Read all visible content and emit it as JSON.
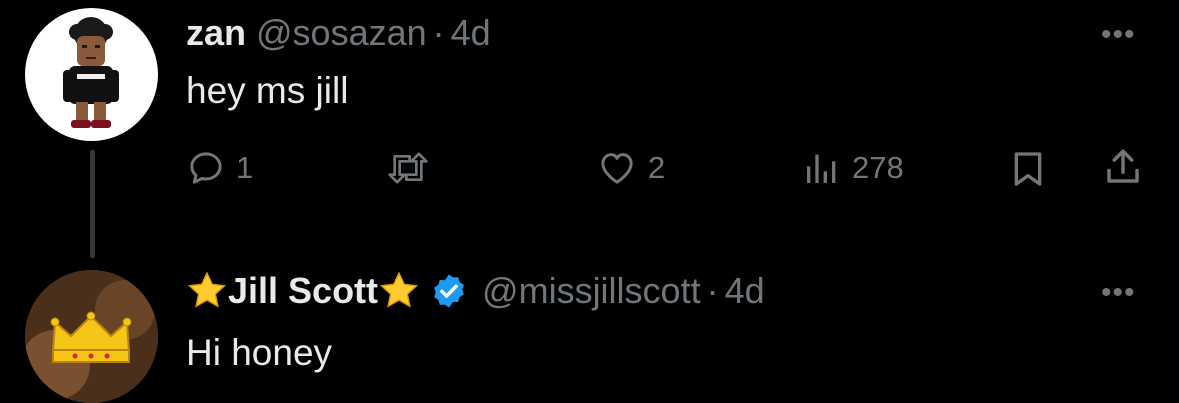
{
  "tweet1": {
    "name": "zan",
    "handle": "@sosazan",
    "separator": "·",
    "time": "4d",
    "text": "hey ms jill",
    "more_label": "•••",
    "actions": {
      "reply_count": "1",
      "like_count": "2",
      "views_count": "278"
    }
  },
  "tweet2": {
    "name": "Jill Scott",
    "handle": "@missjillscott",
    "separator": "·",
    "time": "4d",
    "text": "Hi honey",
    "more_label": "•••"
  },
  "icons": {
    "reply": "reply-icon",
    "retweet": "retweet-icon",
    "like": "heart-icon",
    "views": "views-icon",
    "bookmark": "bookmark-icon",
    "share": "share-icon",
    "verified": "verified-badge-icon",
    "star": "star-emoji"
  },
  "colors": {
    "background": "#000000",
    "text": "#e7e9ea",
    "muted": "#71767b",
    "verified": "#1d9bf0"
  }
}
